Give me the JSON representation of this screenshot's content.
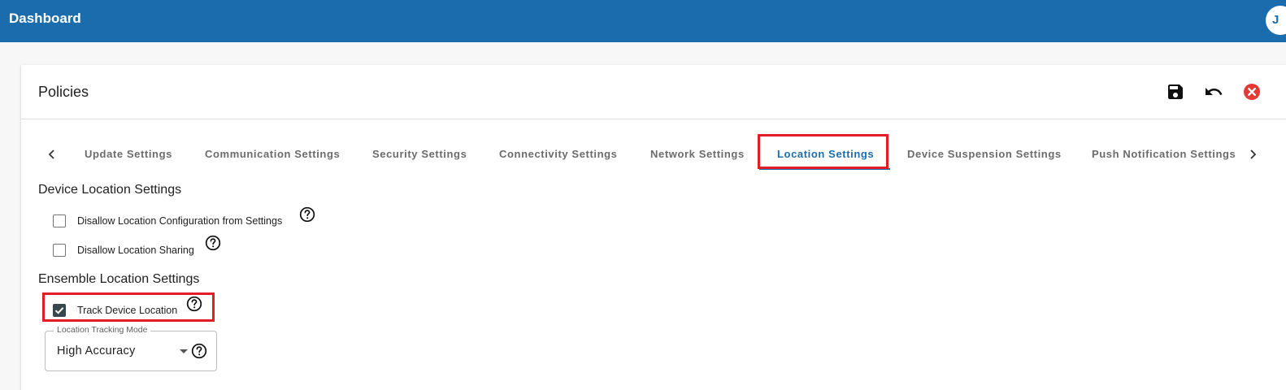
{
  "app": {
    "title": "Dashboard",
    "avatar_initial": "J"
  },
  "card": {
    "title": "Policies"
  },
  "header_actions": [
    {
      "name": "save-icon"
    },
    {
      "name": "undo-icon"
    },
    {
      "name": "close-icon",
      "color": "#e53935"
    }
  ],
  "tabs": {
    "items": [
      {
        "label": "Update Settings"
      },
      {
        "label": "Communication Settings"
      },
      {
        "label": "Security Settings"
      },
      {
        "label": "Connectivity Settings"
      },
      {
        "label": "Network Settings"
      },
      {
        "label": "Location Settings",
        "active": true
      },
      {
        "label": "Device Suspension Settings"
      },
      {
        "label": "Push Notification Settings"
      }
    ],
    "prev_icon": "chevron-left-icon",
    "next_icon": "chevron-right-icon"
  },
  "device_location": {
    "title": "Device Location Settings",
    "options": [
      {
        "label": "Disallow Location Configuration from Settings",
        "checked": false
      },
      {
        "label": "Disallow Location Sharing",
        "checked": false
      }
    ]
  },
  "ensemble_location": {
    "title": "Ensemble Location Settings",
    "track": {
      "label": "Track Device Location",
      "checked": true
    },
    "tracking_mode": {
      "label": "Location Tracking Mode",
      "value": "High Accuracy"
    }
  },
  "colors": {
    "primary": "#1b6cad",
    "highlight": "#e21d25",
    "checkbox_checked": "#37474f"
  }
}
